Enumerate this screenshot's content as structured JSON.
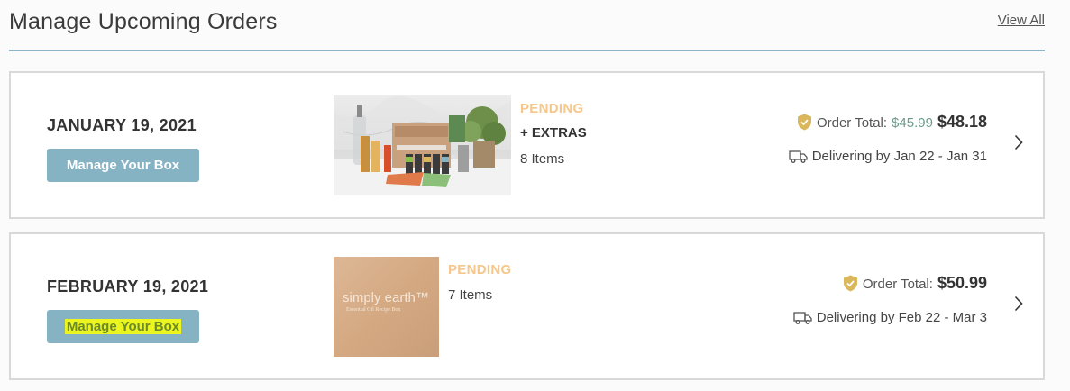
{
  "header": {
    "title": "Manage Upcoming Orders",
    "view_all": "View All"
  },
  "orders": [
    {
      "date": "JANUARY 19, 2021",
      "button": "Manage Your Box",
      "button_highlighted": false,
      "image_icon": "essential-oil-box-photo",
      "status": "PENDING",
      "extras": "+ EXTRAS",
      "items": "8 Items",
      "total_label": "Order Total:",
      "original_price": "$45.99",
      "price": "$48.18",
      "delivery": "Delivering by Jan 22 - Jan 31"
    },
    {
      "date": "FEBRUARY 19, 2021",
      "button": "Manage Your Box",
      "button_highlighted": true,
      "image_icon": "simply-earth-box-photo",
      "image_text": "simply earth™",
      "image_subtext": "Essential Oil Recipe Box",
      "status": "PENDING",
      "items": "7 Items",
      "total_label": "Order Total:",
      "price": "$50.99",
      "delivery": "Delivering by Feb 22 - Mar 3"
    }
  ],
  "colors": {
    "accent": "#86b3c4",
    "pending": "#f6c68b",
    "shield": "#d9b75a",
    "highlight": "#ecf520"
  }
}
